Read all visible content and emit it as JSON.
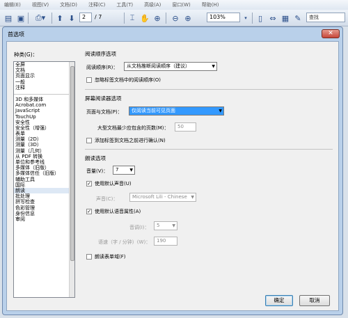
{
  "menubar": {
    "items": [
      "编辑(E)",
      "视图(V)",
      "文档(D)",
      "注释(C)",
      "工具(T)",
      "高级(A)",
      "窗口(W)",
      "帮助(H)"
    ]
  },
  "toolbar": {
    "page_current": "2",
    "page_total": "/ 7",
    "zoom": "103%",
    "find_placeholder": "查找"
  },
  "dialog": {
    "title": "首选项",
    "close_symbol": "✕",
    "category_label": "种类(G)：",
    "categories_top": [
      "全屏",
      "文档",
      "页面显示",
      "一般",
      "注释"
    ],
    "categories": [
      "3D 和多媒体",
      "Acrobat.com",
      "JavaScript",
      "TouchUp",
      "安全性",
      "安全性（增强）",
      "表单",
      "测量（2D）",
      "测量（3D）",
      "测量（几何）",
      "从 PDF 转换",
      "单位和参考线",
      "多媒体（旧版）",
      "多媒体信任（旧版）",
      "辅助工具",
      "国际",
      "朗读",
      "批处理",
      "拼写检查",
      "色彩管理",
      "身份信息",
      "审阅"
    ],
    "selected_category": "朗读",
    "reading_order": {
      "section_title": "阅读顺序选项",
      "order_label": "阅读顺序(R)：",
      "order_value": "从文档推断阅读顺序（建议）",
      "override_label": "忽略标签文档中的阅读顺序(O)"
    },
    "screen_reader": {
      "section_title": "屏幕阅读器选项",
      "page_doc_label": "页面与文档(P)：",
      "page_doc_value": "仅阅读当前可见页面",
      "max_pages_label": "大型文档最少应包含的页数(M)：",
      "max_pages_value": "50",
      "confirm_label": "添加标签到文档之前进行确认(N)"
    },
    "read_out_loud": {
      "section_title": "朗读选项",
      "volume_label": "音量(V)：",
      "volume_value": "7",
      "default_voice_label": "使用默认声音(U)",
      "default_voice_checked": "✓",
      "voice_label": "声音(C)：",
      "voice_value": "Microsoft Lili - Chinese",
      "default_speech_label": "使用默认语音属性(A)",
      "default_speech_checked": "✓",
      "pitch_label": "音调(I)：",
      "pitch_value": "5",
      "rate_label": "语速（字 / 分钟）(W)：",
      "rate_value": "190",
      "form_fields_label": "朗读表单域(F)"
    },
    "ok_label": "确定",
    "cancel_label": "取消"
  }
}
